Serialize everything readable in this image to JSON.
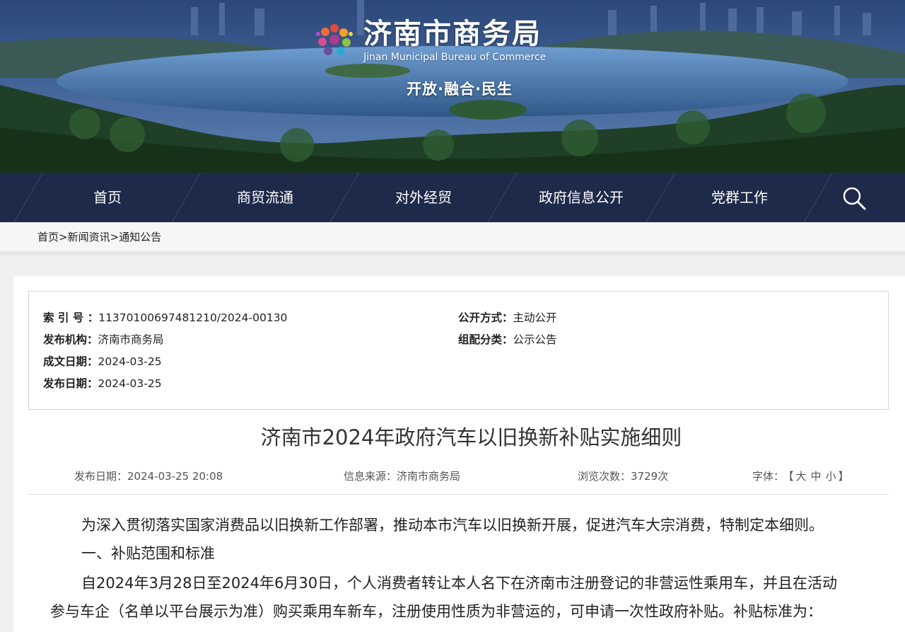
{
  "header": {
    "site_title": "济南市商务局",
    "site_subtitle": "Jinan Municipal Bureau of Commerce",
    "slogan": "开放·融合·民生"
  },
  "nav": {
    "items": [
      {
        "label": "首页"
      },
      {
        "label": "商贸流通"
      },
      {
        "label": "对外经贸"
      },
      {
        "label": "政府信息公开"
      },
      {
        "label": "党群工作"
      }
    ],
    "search_icon": "search-icon"
  },
  "breadcrumb": {
    "home": "首页",
    "sep": ">",
    "section": "新闻资讯",
    "page": "通知公告"
  },
  "meta": {
    "index_label": "索 引 号 ：",
    "index_value": "11370100697481210/2024-00130",
    "org_label": "发布机构：",
    "org_value": "济南市商务局",
    "written_label": "成文日期：",
    "written_value": "2024-03-25",
    "publish_label": "发布日期：",
    "publish_value": "2024-03-25",
    "disclosure_label": "公开方式：",
    "disclosure_value": "主动公开",
    "category_label": "组配分类：",
    "category_value": "公示公告"
  },
  "article": {
    "title": "济南市2024年政府汽车以旧换新补贴实施细则",
    "date_label": "发布日期：",
    "date_value": "2024-03-25 20:08",
    "source_label": "信息来源：",
    "source_value": "济南市商务局",
    "views_label": "浏览次数：",
    "views_value": "3729次",
    "font_label": "字体：",
    "font_open": "【",
    "font_large": "大",
    "font_medium": "中",
    "font_small": "小",
    "font_close": "】",
    "paragraphs": [
      "为深入贯彻落实国家消费品以旧换新工作部署，推动本市汽车以旧换新开展，促进汽车大宗消费，特制定本细则。",
      "一、补贴范围和标准",
      "自2024年3月28日至2024年6月30日，个人消费者转让本人名下在济南市注册登记的非营运性乘用车，并且在活动",
      "参与车企（名单以平台展示为准）购买乘用车新车，注册使用性质为非营运的，可申请一次性政府补贴。补贴标准为："
    ]
  },
  "colors": {
    "nav_bg": "#1e2a4a",
    "breadcrumb_bg": "#f6f6f6",
    "page_bg": "#f0f0f0"
  }
}
